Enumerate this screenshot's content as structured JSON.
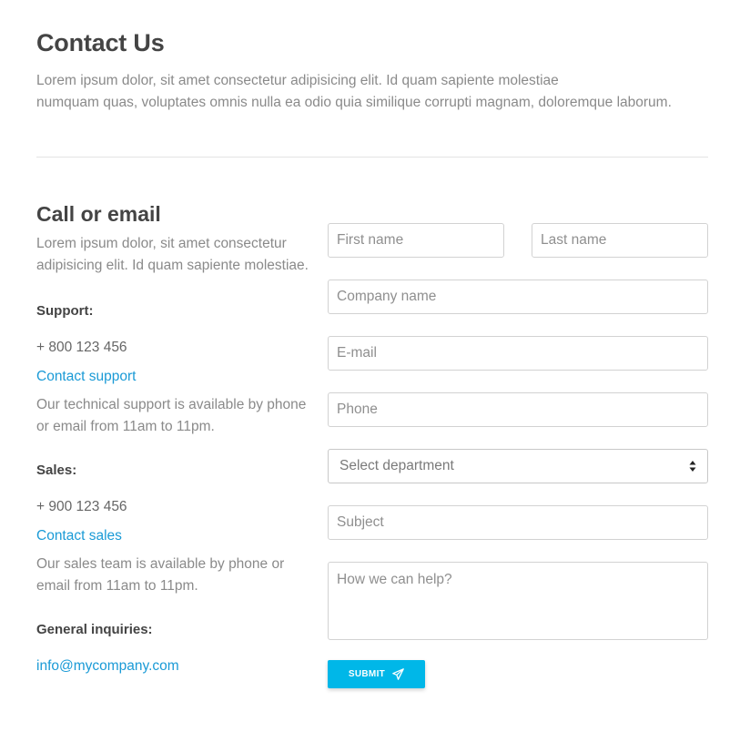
{
  "header": {
    "title": "Contact Us",
    "intro_line1": "Lorem ipsum dolor, sit amet consectetur adipisicing elit. Id quam sapiente molestiae",
    "intro_line2": "numquam quas, voluptates omnis nulla ea odio quia similique corrupti magnam, doloremque laborum."
  },
  "contact": {
    "title": "Call or email",
    "description": "Lorem ipsum dolor, sit amet consectetur adipisicing elit. Id quam sapiente molestiae.",
    "support": {
      "label": "Support:",
      "phone": "+ 800 123 456",
      "link": "Contact support",
      "note": "Our technical support is available by phone or email from 11am to 11pm."
    },
    "sales": {
      "label": "Sales:",
      "phone": "+ 900 123 456",
      "link": "Contact sales",
      "note": "Our sales team is available by phone or email from 11am to 11pm."
    },
    "general": {
      "label": "General inquiries:",
      "email": "info@mycompany.com"
    }
  },
  "form": {
    "first_name_placeholder": "First name",
    "last_name_placeholder": "Last name",
    "company_placeholder": "Company name",
    "email_placeholder": "E-mail",
    "phone_placeholder": "Phone",
    "department_selected": "Select department",
    "subject_placeholder": "Subject",
    "message_placeholder": "How we can help?",
    "submit_label": "SUBMIT",
    "submit_icon": "paper-plane-icon"
  },
  "colors": {
    "accent": "#00b7e8",
    "link": "#1a9ad6",
    "heading": "#444444",
    "muted": "#8a8a8a"
  }
}
